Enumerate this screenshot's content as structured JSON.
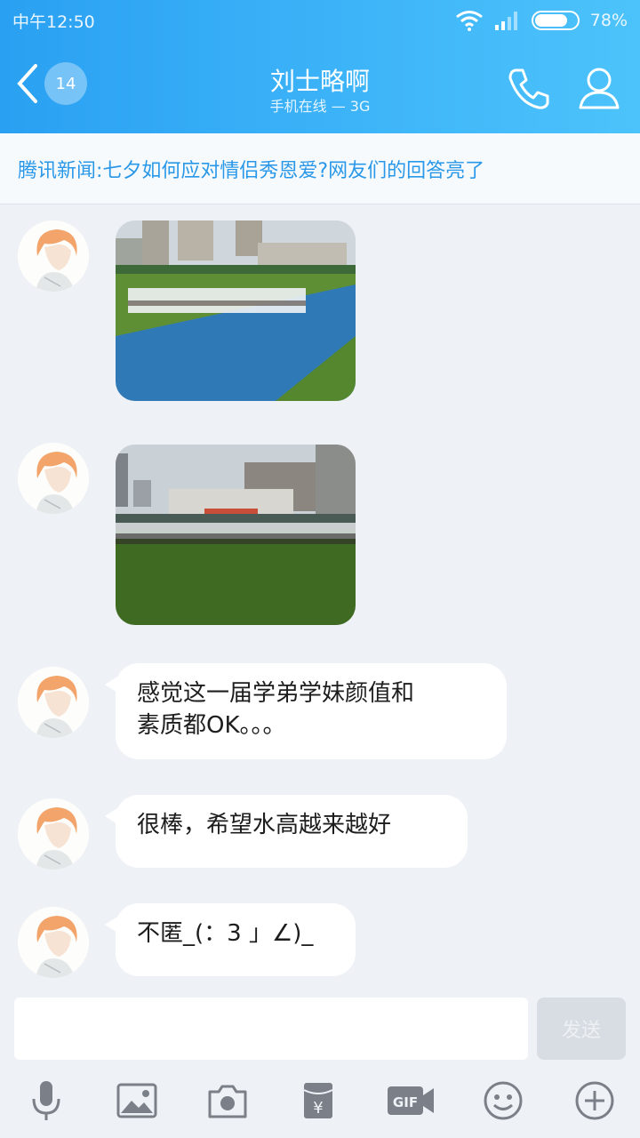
{
  "status": {
    "carrier_time": "中午12:50",
    "battery": "78%",
    "battery_level": 0.78
  },
  "header": {
    "unread_count": "14",
    "title": "刘士略啊",
    "subtitle": "手机在线 — 3G"
  },
  "news": {
    "text": "腾讯新闻:七夕如何应对情侣秀恩爱?网友们的回答亮了"
  },
  "messages": [
    {
      "type": "image",
      "scene": "sports field assembly with buildings"
    },
    {
      "type": "image",
      "scene": "crowd on grass field in front of stage"
    },
    {
      "type": "text",
      "lines": [
        "感觉这一届学弟学妹颜值和",
        "素质都OK。。。"
      ]
    },
    {
      "type": "text",
      "lines": [
        "很棒，希望水高越来越好"
      ]
    },
    {
      "type": "text",
      "lines": [
        "不匿_(：3 」∠)_"
      ]
    }
  ],
  "composer": {
    "placeholder": "",
    "send_label": "发送"
  },
  "toolbar": {
    "icons": [
      "microphone-icon",
      "image-icon",
      "camera-icon",
      "red-packet-icon",
      "gif-icon",
      "emoji-icon",
      "plus-icon"
    ]
  },
  "colors": {
    "header_start": "#2aa0f2",
    "header_end": "#4dc3fb",
    "news_text": "#2a98e8",
    "background": "#eef1f6",
    "icon_gray": "#7b8088"
  }
}
